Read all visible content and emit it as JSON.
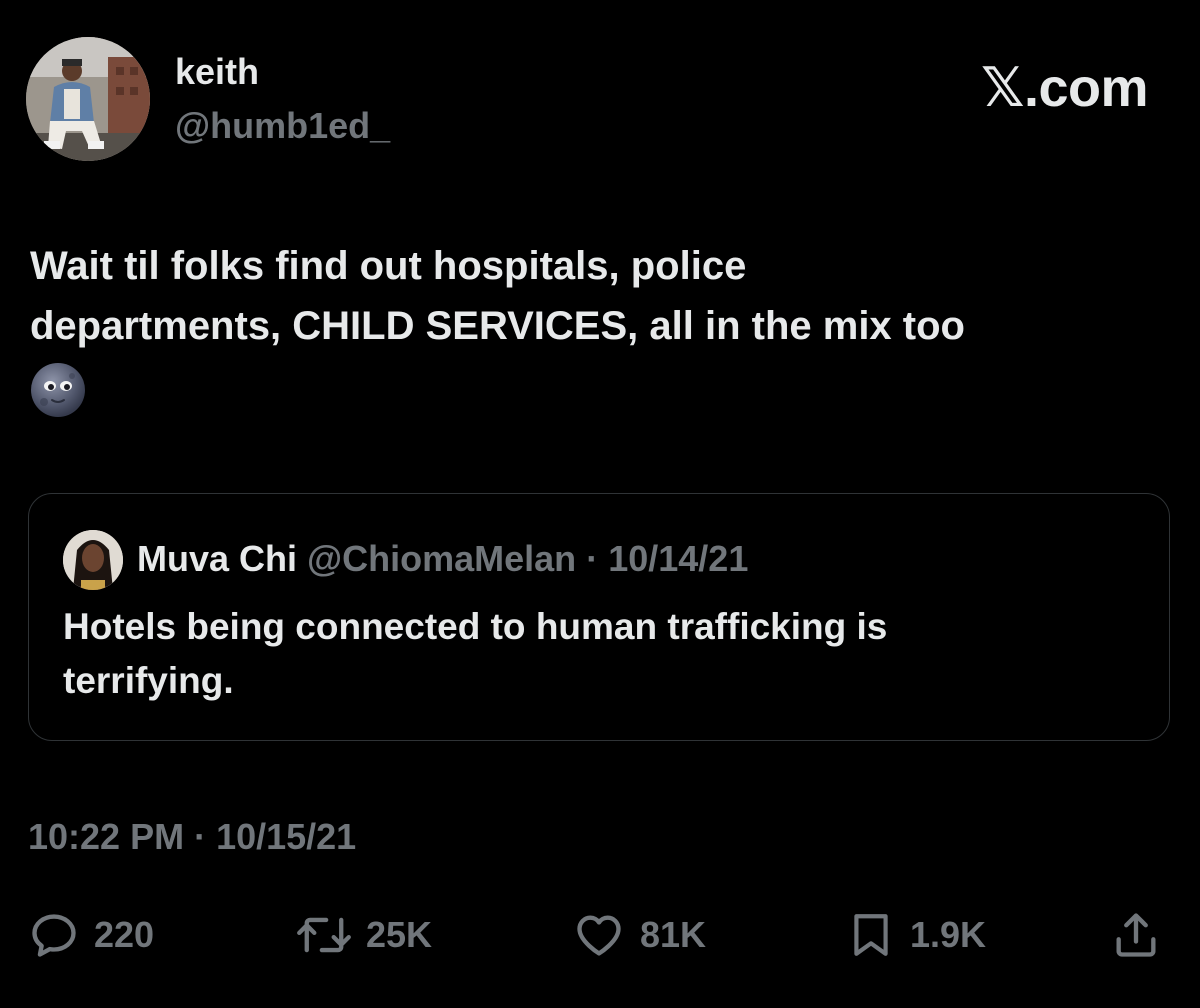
{
  "author": {
    "display_name": "keith",
    "handle": "@humb1ed_"
  },
  "brand": "𝕏.com",
  "tweet": {
    "text_lines": [
      "Wait til folks find out hospitals, police",
      "departments, CHILD SERVICES, all in the mix too"
    ],
    "emoji": "new-moon-face-emoji"
  },
  "quoted_tweet": {
    "display_name": "Muva Chi",
    "handle": "@ChiomaMelan",
    "separator": "·",
    "date": "10/14/21",
    "text_lines": [
      "Hotels being connected to human trafficking is",
      "terrifying."
    ]
  },
  "timestamp": "10:22 PM · 10/15/21",
  "actions": {
    "reply": {
      "icon": "reply-icon",
      "count": "220"
    },
    "repost": {
      "icon": "repost-icon",
      "count": "25K"
    },
    "like": {
      "icon": "heart-icon",
      "count": "81K"
    },
    "bookmark": {
      "icon": "bookmark-icon",
      "count": "1.9K"
    },
    "share": {
      "icon": "share-icon"
    }
  },
  "colors": {
    "background": "#000000",
    "primary_text": "#e7e9ea",
    "secondary_text": "#71767b",
    "border": "#2f3336"
  }
}
